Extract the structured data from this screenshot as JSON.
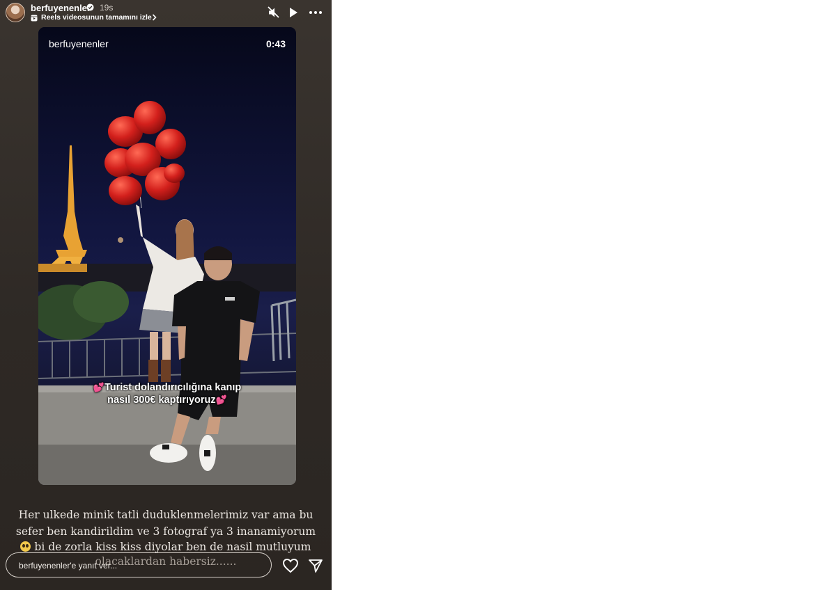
{
  "story": {
    "username": "berfuyenenler",
    "time_ago": "19s",
    "reels_link": "Reels videosunun tamamını izle",
    "controls": [
      "mute-icon",
      "play-icon",
      "more-icon"
    ]
  },
  "video": {
    "username": "berfuyenenler",
    "duration": "0:43",
    "caption_line1": "Turist dolandırıcılığına kanıp",
    "caption_line2": "nasıl 300€ kaptırıyoruz",
    "heart_emoji": "💕"
  },
  "text": {
    "line1": "Her ulkede minik tatli duduklenmelerimiz var ama bu",
    "line2": "sefer ben kandirildim ve 3 fotograf ya 3 inanamiyorum",
    "line3": "bi de zorla kiss kiss diyolar ben de nasil mutluyum",
    "line4": "olacaklardan habersiz......"
  },
  "reply": {
    "placeholder": "berfuyenenler'e yanıt ver..."
  },
  "colors": {
    "background": "#2e2925",
    "balloon": "#d3201c",
    "heart_emoji": "#ff5fb5"
  }
}
